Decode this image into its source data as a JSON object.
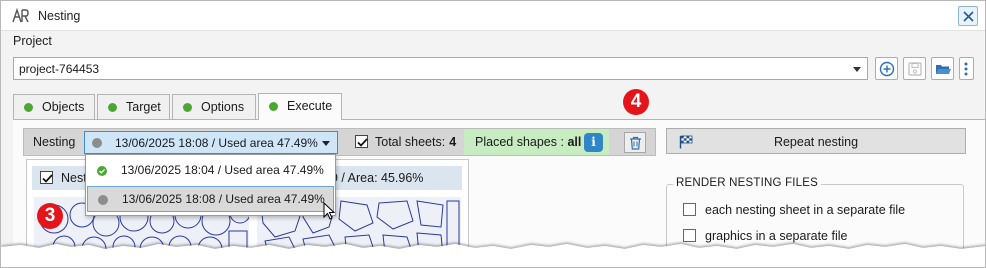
{
  "window": {
    "title": "Nesting",
    "close_icon": "close-icon"
  },
  "project": {
    "label": "Project",
    "value": "project-764453",
    "tools": [
      "add-circle-icon",
      "save-icon",
      "folder-open-icon",
      "more-vertical-icon"
    ]
  },
  "tabs": [
    {
      "label": "Objects",
      "status": "green"
    },
    {
      "label": "Target",
      "status": "green"
    },
    {
      "label": "Options",
      "status": "green"
    },
    {
      "label": "Execute",
      "status": "green",
      "active": true
    }
  ],
  "nesting_bar": {
    "label": "Nesting",
    "selected": "13/06/2025 18:08 / Used area 47.49%",
    "total_sheets_label": "Total sheets:",
    "total_sheets_value": "4",
    "total_sheets_checked": true,
    "placed_label": "Placed shapes :",
    "placed_value": "all",
    "info_icon": "info-icon",
    "delete_icon": "trash-icon"
  },
  "dropdown": {
    "items": [
      {
        "label": "13/06/2025 18:04 / Used area 47.49%",
        "status": "success"
      },
      {
        "label": "13/06/2025 18:08 / Used area 47.49%",
        "status": "neutral",
        "selected": true
      }
    ]
  },
  "sheet_header": {
    "label": "Nest",
    "checked": true,
    "right_text": "9 / Area: 45.96%"
  },
  "repeat_button": {
    "label": "Repeat nesting",
    "icon": "checkered-flag-icon"
  },
  "render_files": {
    "title": "RENDER NESTING FILES",
    "options": [
      {
        "label": "each nesting sheet in a separate file",
        "checked": false
      },
      {
        "label": "graphics in a separate file",
        "checked": false
      }
    ]
  },
  "callouts": [
    "3",
    "4"
  ],
  "colors": {
    "accent": "#3c8ed6",
    "success": "#4aa832",
    "placed_bg": "#c8ecc2",
    "info": "#2f86c7",
    "callout": "#e4151a"
  }
}
